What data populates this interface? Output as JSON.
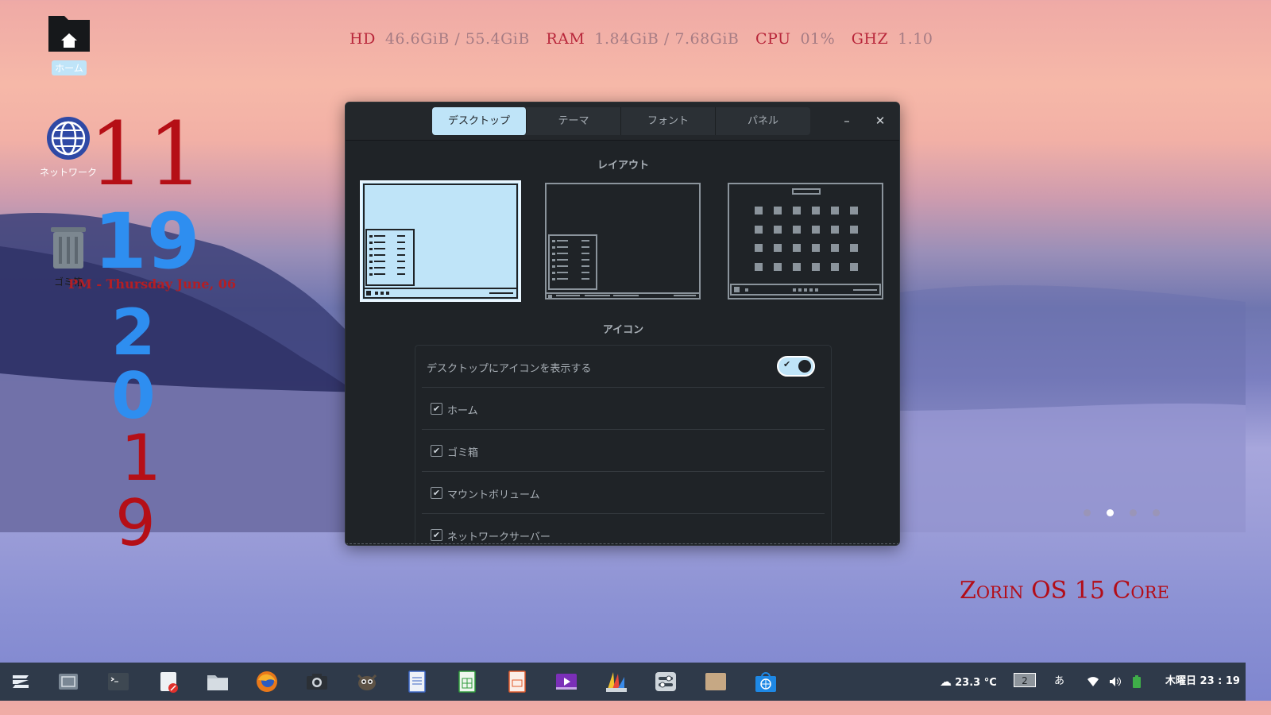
{
  "sysinfo": {
    "hd_label": "HD",
    "hd_value": "46.6GiB / 55.4GiB",
    "ram_label": "RAM",
    "ram_value": "1.84GiB / 7.68GiB",
    "cpu_label": "CPU",
    "cpu_value": "01%",
    "ghz_label": "GHZ",
    "ghz_value": "1.10"
  },
  "desktop_icons": {
    "home": "ホーム",
    "network": "ネットワーク",
    "trash": "ゴミ箱"
  },
  "clock": {
    "hour": "11",
    "minute": "19",
    "date_line": "PM - Thursday June, 06",
    "year_digits": [
      "2",
      "0",
      "1",
      "9"
    ]
  },
  "brand": "Zorin OS 15 Core",
  "settings_window": {
    "tabs": [
      "デスクトップ",
      "テーマ",
      "フォント",
      "パネル"
    ],
    "active_tab": 0,
    "minimize": "–",
    "close": "✕",
    "layout_heading": "レイアウト",
    "icons_heading": "アイコン",
    "show_icons_label": "デスクトップにアイコンを表示する",
    "show_icons_on": true,
    "checkbox_items": [
      "ホーム",
      "ゴミ箱",
      "マウントボリューム",
      "ネットワークサーバー"
    ]
  },
  "taskbar": {
    "weather": "23.3 °C",
    "workspace": "2",
    "input_method": "あ",
    "datetime": "木曜日 23 : 19",
    "apps": [
      "zorin-menu-icon",
      "screenshot-icon",
      "terminal-icon",
      "text-editor-icon",
      "files-icon",
      "firefox-icon",
      "camera-icon",
      "gimp-icon",
      "writer-icon",
      "calc-icon",
      "impress-icon",
      "video-editor-icon",
      "design-icon",
      "settings-icon",
      "archive-icon",
      "store-icon"
    ]
  },
  "colors": {
    "accent": "#bfe4f8",
    "window_bg": "#1f2327",
    "taskbar_bg": "#2f3a4a",
    "clock_red": "#b50f16",
    "clock_blue": "#2e8ef0"
  }
}
